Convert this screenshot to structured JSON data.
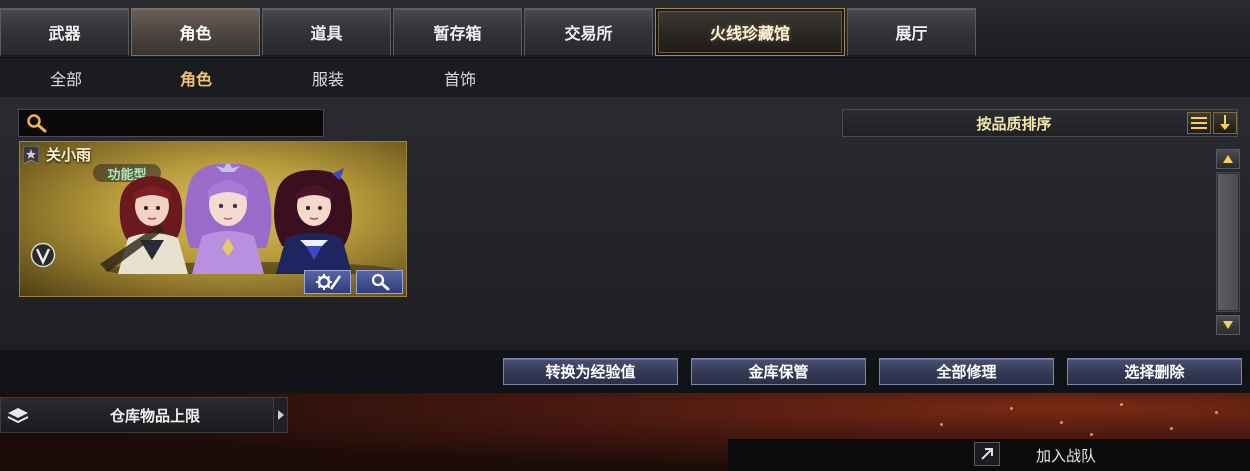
{
  "top_tabs": [
    {
      "label": "武器"
    },
    {
      "label": "角色"
    },
    {
      "label": "道具"
    },
    {
      "label": "暂存箱"
    },
    {
      "label": "交易所"
    },
    {
      "label": "火线珍藏馆"
    },
    {
      "label": "展厅"
    }
  ],
  "top_tabs_active": "角色",
  "sub_tabs": [
    {
      "label": "全部"
    },
    {
      "label": "角色"
    },
    {
      "label": "服装"
    },
    {
      "label": "首饰"
    }
  ],
  "sub_tabs_active": "角色",
  "search": {
    "value": "",
    "placeholder": "",
    "icon": "search-icon"
  },
  "sort": {
    "label": "按品质排序",
    "list_icon": "list-icon",
    "order_icon": "arrow-down-icon"
  },
  "items": [
    {
      "name": "关小雨",
      "type_tag": "功能型",
      "badge_icon": "star-badge-icon",
      "v_icon": "v-badge-icon",
      "buttons": [
        {
          "icon": "settings-icon"
        },
        {
          "icon": "search-icon"
        }
      ]
    }
  ],
  "actions": {
    "convert": "转换为经验值",
    "vault": "金库保管",
    "repair_all": "全部修理",
    "select_delete": "选择删除"
  },
  "inventory": {
    "label": "仓库物品上限",
    "icon": "layers-icon"
  },
  "team": {
    "label": "加入战队",
    "icon": "external-arrow-icon"
  },
  "colors": {
    "accent_gold": "#f3c36b",
    "card_gold": "#b99c3c",
    "button_blue": "#353a57",
    "tag_green": "#a8e6c4"
  }
}
